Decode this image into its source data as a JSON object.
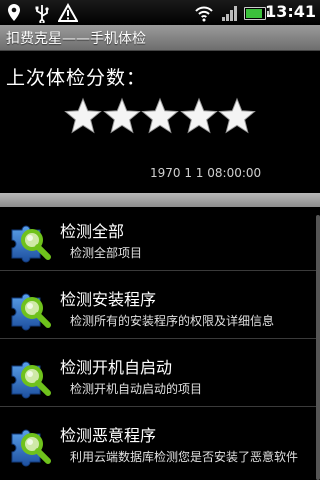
{
  "status_bar": {
    "time": "13:41",
    "battery_level": 0.9,
    "icons": [
      "location-icon",
      "usb-icon",
      "warning-icon",
      "wifi-icon",
      "signal-icon",
      "battery-icon"
    ]
  },
  "title_bar": {
    "title": "扣费克星——手机体检"
  },
  "score": {
    "label": "上次体检分数：",
    "stars_filled": 5,
    "stars_total": 5,
    "timestamp": "1970 1 1 08:00:00"
  },
  "colors": {
    "accent_green": "#3cc13c",
    "title_bar_gray": "#8a8a8a",
    "icon_blue": "#2f6fc1",
    "magnifier_green": "#7ccf2a"
  },
  "list": {
    "items": [
      {
        "title": "检测全部",
        "description": "检测全部项目",
        "icon": "puzzle-magnifier-icon"
      },
      {
        "title": "检测安装程序",
        "description": "检测所有的安装程序的权限及详细信息",
        "icon": "puzzle-magnifier-icon"
      },
      {
        "title": "检测开机自启动",
        "description": "检测开机自动启动的项目",
        "icon": "puzzle-magnifier-icon"
      },
      {
        "title": "检测恶意程序",
        "description": "利用云端数据库检测您是否安装了恶意软件",
        "icon": "puzzle-magnifier-icon"
      }
    ]
  }
}
